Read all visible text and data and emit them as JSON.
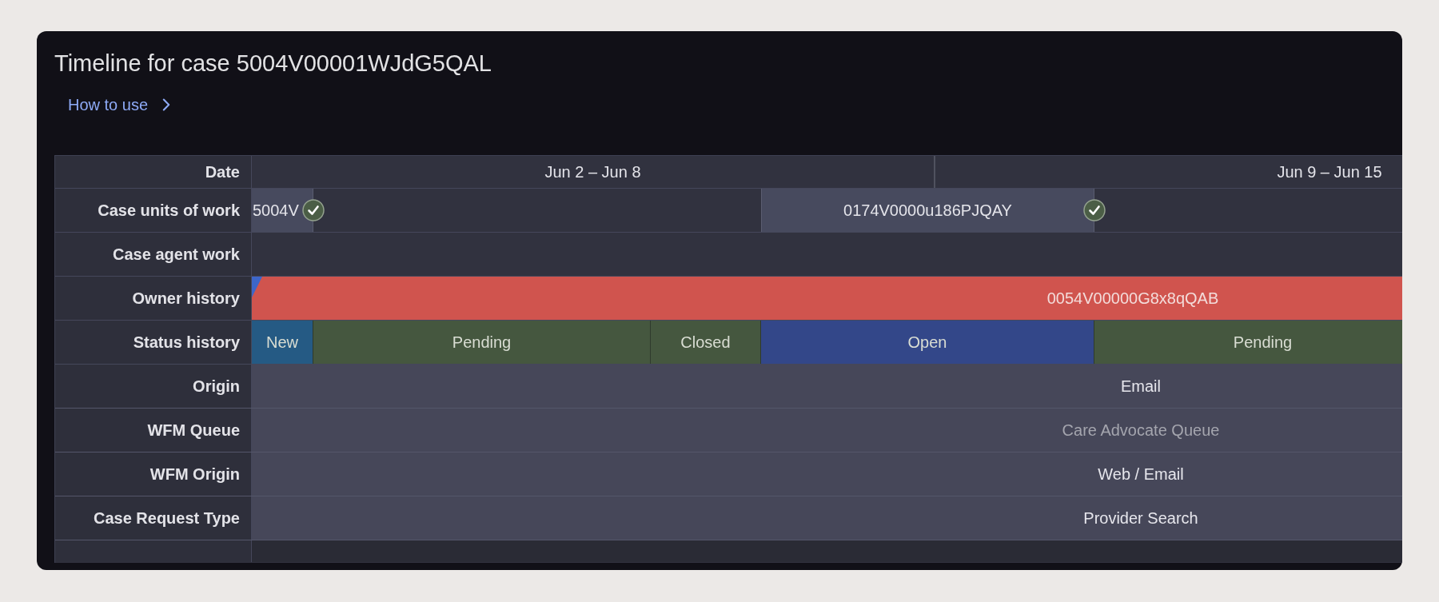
{
  "title": "Timeline for case 5004V00001WJdG5QAL",
  "help_link": {
    "label": "How to use"
  },
  "timeline": {
    "header": {
      "label": "Date",
      "ranges": [
        "Jun 2 – Jun 8",
        "Jun 9 – Jun 15"
      ]
    },
    "rows": [
      {
        "label": "Case units of work",
        "kind": "units",
        "segments": [
          {
            "text": "5004V",
            "completed": true
          },
          {
            "text": "0174V0000u186PJQAY",
            "completed": true
          }
        ]
      },
      {
        "label": "Case agent work",
        "kind": "empty"
      },
      {
        "label": "Owner history",
        "kind": "owners",
        "segments": [
          {
            "kind": "sliver",
            "color": "#3d66c9"
          },
          {
            "kind": "bar",
            "text": "0054V00000G8x8qQAB",
            "color": "#d0544e"
          }
        ]
      },
      {
        "label": "Status history",
        "kind": "statuses",
        "segments": [
          {
            "text": "New",
            "color": "#255a84"
          },
          {
            "text": "Pending",
            "color": "#45573f"
          },
          {
            "text": "Closed",
            "color": "#45573f"
          },
          {
            "text": "Open",
            "color": "#334789"
          },
          {
            "text": "Pending",
            "color": "#45573f"
          }
        ]
      },
      {
        "label": "Origin",
        "kind": "value",
        "value": "Email",
        "dimmed": false
      },
      {
        "label": "WFM Queue",
        "kind": "value",
        "value": "Care Advocate Queue",
        "dimmed": true
      },
      {
        "label": "WFM Origin",
        "kind": "value",
        "value": "Web / Email",
        "dimmed": false
      },
      {
        "label": "Case Request Type",
        "kind": "value",
        "value": "Provider Search",
        "dimmed": false
      }
    ]
  }
}
